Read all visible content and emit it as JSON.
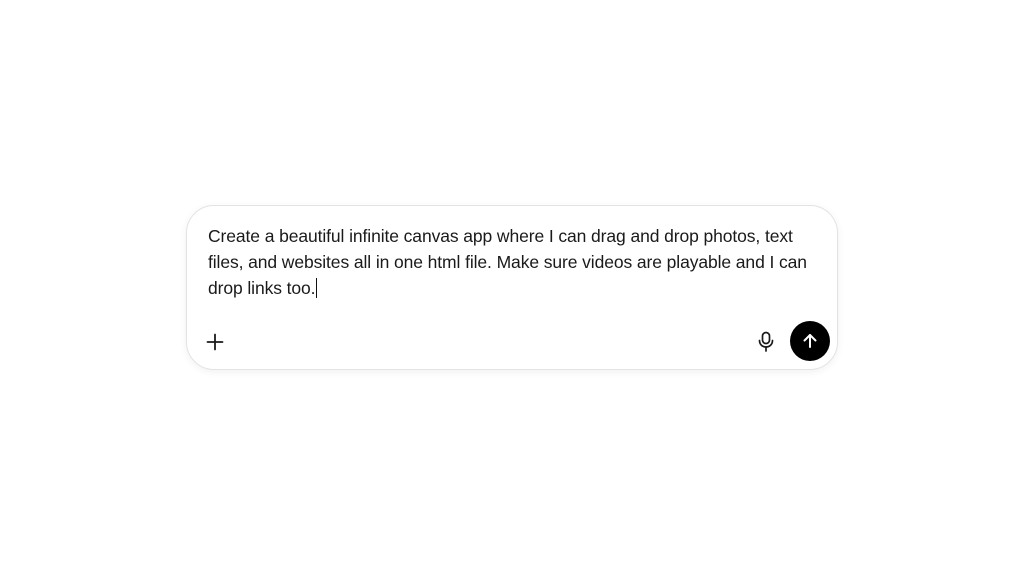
{
  "composer": {
    "prompt_text": "Create a beautiful infinite canvas app where I can drag and drop photos, text files, and websites all in one html file. Make sure videos are playable and I can drop links too.",
    "icons": {
      "add": "plus-icon",
      "mic": "microphone-icon",
      "send": "arrow-up-icon"
    },
    "colors": {
      "send_bg": "#000000",
      "send_fg": "#ffffff",
      "text": "#1a1a1a",
      "border": "#e3e3e3"
    }
  }
}
